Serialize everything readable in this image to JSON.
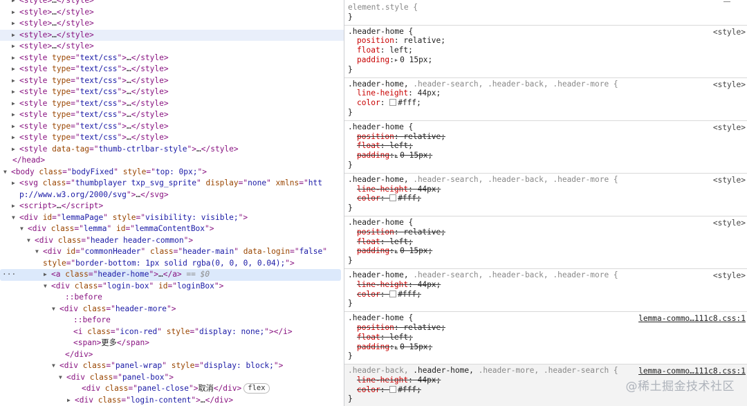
{
  "elements_tree": {
    "rows": [
      {
        "indent": 28,
        "arrow": "▶",
        "html": "<span class=\"tag\">&lt;style&gt;</span><span class=\"tx\">…</span><span class=\"tag\">&lt;/style&gt;</span>",
        "offset": -7
      },
      {
        "indent": 28,
        "arrow": "▶",
        "html": "<span class=\"tag\">&lt;style&gt;</span><span class=\"tx\">…</span><span class=\"tag\">&lt;/style&gt;</span>"
      },
      {
        "indent": 28,
        "arrow": "▶",
        "html": "<span class=\"tag\">&lt;style&gt;</span><span class=\"tx\">…</span><span class=\"tag\">&lt;/style&gt;</span>"
      },
      {
        "indent": 28,
        "arrow": "▶",
        "hl": "hover",
        "html": "<span class=\"tag\">&lt;style&gt;</span><span class=\"tx\">…</span><span class=\"tag\">&lt;/style&gt;</span>"
      },
      {
        "indent": 28,
        "arrow": "▶",
        "html": "<span class=\"tag\">&lt;style&gt;</span><span class=\"tx\">…</span><span class=\"tag\">&lt;/style&gt;</span>"
      },
      {
        "indent": 28,
        "arrow": "▶",
        "html": "<span class=\"tag\">&lt;style </span><span class=\"an\">type</span><span class=\"tag\">=\"</span><span class=\"av\">text/css</span><span class=\"tag\">\"&gt;</span><span class=\"tx\">…</span><span class=\"tag\">&lt;/style&gt;</span>"
      },
      {
        "indent": 28,
        "arrow": "▶",
        "html": "<span class=\"tag\">&lt;style </span><span class=\"an\">type</span><span class=\"tag\">=\"</span><span class=\"av\">text/css</span><span class=\"tag\">\"&gt;</span><span class=\"tx\">…</span><span class=\"tag\">&lt;/style&gt;</span>"
      },
      {
        "indent": 28,
        "arrow": "▶",
        "html": "<span class=\"tag\">&lt;style </span><span class=\"an\">type</span><span class=\"tag\">=\"</span><span class=\"av\">text/css</span><span class=\"tag\">\"&gt;</span><span class=\"tx\">…</span><span class=\"tag\">&lt;/style&gt;</span>"
      },
      {
        "indent": 28,
        "arrow": "▶",
        "html": "<span class=\"tag\">&lt;style </span><span class=\"an\">type</span><span class=\"tag\">=\"</span><span class=\"av\">text/css</span><span class=\"tag\">\"&gt;</span><span class=\"tx\">…</span><span class=\"tag\">&lt;/style&gt;</span>"
      },
      {
        "indent": 28,
        "arrow": "▶",
        "html": "<span class=\"tag\">&lt;style </span><span class=\"an\">type</span><span class=\"tag\">=\"</span><span class=\"av\">text/css</span><span class=\"tag\">\"&gt;</span><span class=\"tx\">…</span><span class=\"tag\">&lt;/style&gt;</span>"
      },
      {
        "indent": 28,
        "arrow": "▶",
        "html": "<span class=\"tag\">&lt;style </span><span class=\"an\">type</span><span class=\"tag\">=\"</span><span class=\"av\">text/css</span><span class=\"tag\">\"&gt;</span><span class=\"tx\">…</span><span class=\"tag\">&lt;/style&gt;</span>"
      },
      {
        "indent": 28,
        "arrow": "▶",
        "html": "<span class=\"tag\">&lt;style </span><span class=\"an\">type</span><span class=\"tag\">=\"</span><span class=\"av\">text/css</span><span class=\"tag\">\"&gt;</span><span class=\"tx\">…</span><span class=\"tag\">&lt;/style&gt;</span>"
      },
      {
        "indent": 28,
        "arrow": "▶",
        "html": "<span class=\"tag\">&lt;style </span><span class=\"an\">type</span><span class=\"tag\">=\"</span><span class=\"av\">text/css</span><span class=\"tag\">\"&gt;</span><span class=\"tx\">…</span><span class=\"tag\">&lt;/style&gt;</span>"
      },
      {
        "indent": 28,
        "arrow": "▶",
        "html": "<span class=\"tag\">&lt;style </span><span class=\"an\">data-tag</span><span class=\"tag\">=\"</span><span class=\"av\">thumb-ctrlbar-style</span><span class=\"tag\">\"&gt;</span><span class=\"tx\">…</span><span class=\"tag\">&lt;/style&gt;</span>"
      },
      {
        "indent": 28,
        "arrow": "",
        "html": "<span class=\"tag\">&lt;/head&gt;</span>",
        "shift": -10
      },
      {
        "indent": 16,
        "arrow": "▼",
        "html": "<span class=\"tag\">&lt;body </span><span class=\"an\">class</span><span class=\"tag\">=\"</span><span class=\"av\">bodyFixed</span><span class=\"tag\">\" </span><span class=\"an\">style</span><span class=\"tag\">=\"</span><span class=\"av\">top: 0px;</span><span class=\"tag\">\"&gt;</span>"
      },
      {
        "indent": 28,
        "arrow": "▶",
        "html": "<span class=\"tag\">&lt;svg </span><span class=\"an\">class</span><span class=\"tag\">=\"</span><span class=\"av\">thumbplayer txp_svg_sprite</span><span class=\"tag\">\" </span><span class=\"an\">display</span><span class=\"tag\">=\"</span><span class=\"av\">none</span><span class=\"tag\">\" </span><span class=\"an\">xmlns</span><span class=\"tag\">=\"</span><span class=\"av\">htt</span>"
      },
      {
        "indent": 28,
        "arrow": "",
        "html": "<span class=\"av\">p://www.w3.org/2000/svg</span><span class=\"tag\">\"&gt;</span><span class=\"tx\">…</span><span class=\"tag\">&lt;/svg&gt;</span>"
      },
      {
        "indent": 28,
        "arrow": "▶",
        "html": "<span class=\"tag\">&lt;script&gt;</span><span class=\"tx\">…</span><span class=\"tag\">&lt;/script&gt;</span>"
      },
      {
        "indent": 28,
        "arrow": "▼",
        "html": "<span class=\"tag\">&lt;div </span><span class=\"an\">id</span><span class=\"tag\">=\"</span><span class=\"av\">lemmaPage</span><span class=\"tag\">\" </span><span class=\"an\">style</span><span class=\"tag\">=\"</span><span class=\"av\">visibility: visible;</span><span class=\"tag\">\"&gt;</span>"
      },
      {
        "indent": 40,
        "arrow": "▼",
        "html": "<span class=\"tag\">&lt;div </span><span class=\"an\">class</span><span class=\"tag\">=\"</span><span class=\"av\">lemma</span><span class=\"tag\">\" </span><span class=\"an\">id</span><span class=\"tag\">=\"</span><span class=\"av\">lemmaContentBox</span><span class=\"tag\">\"&gt;</span>"
      },
      {
        "indent": 50,
        "arrow": "▼",
        "html": "<span class=\"tag\">&lt;div </span><span class=\"an\">class</span><span class=\"tag\">=\"</span><span class=\"av\">header header-common</span><span class=\"tag\">\"&gt;</span>"
      },
      {
        "indent": 62,
        "arrow": "▼",
        "html": "<span class=\"tag\">&lt;div </span><span class=\"an\">id</span><span class=\"tag\">=\"</span><span class=\"av\">commonHeader</span><span class=\"tag\">\" </span><span class=\"an\">class</span><span class=\"tag\">=\"</span><span class=\"av\">header-main</span><span class=\"tag\">\" </span><span class=\"an\">data-login</span><span class=\"tag\">=\"</span><span class=\"av\">false</span><span class=\"tag\">\"</span>"
      },
      {
        "indent": 62,
        "arrow": "",
        "html": "<span class=\"an\">style</span><span class=\"tag\">=\"</span><span class=\"av\">border-bottom: 1px solid rgba(0, 0, 0, 0.04);</span><span class=\"tag\">\"&gt;</span>"
      },
      {
        "indent": 74,
        "arrow": "▶",
        "hl": "selected",
        "dots": "···",
        "html": "<span class=\"tag\">&lt;a </span><span class=\"an\">class</span><span class=\"tag\">=\"</span><span class=\"av\">header-home</span><span class=\"tag\">\"&gt;</span><span class=\"tx\">…</span><span class=\"tag\">&lt;/a&gt;</span><span class=\"eq\"> == $0</span>"
      },
      {
        "indent": 74,
        "arrow": "▼",
        "html": "<span class=\"tag\">&lt;div </span><span class=\"an\">class</span><span class=\"tag\">=\"</span><span class=\"av\">login-box</span><span class=\"tag\">\" </span><span class=\"an\">id</span><span class=\"tag\">=\"</span><span class=\"av\">loginBox</span><span class=\"tag\">\"&gt;</span>"
      },
      {
        "indent": 94,
        "arrow": "",
        "html": "<span class=\"pseudo\">::before</span>"
      },
      {
        "indent": 86,
        "arrow": "▼",
        "html": "<span class=\"tag\">&lt;div </span><span class=\"an\">class</span><span class=\"tag\">=\"</span><span class=\"av\">header-more</span><span class=\"tag\">\"&gt;</span>"
      },
      {
        "indent": 106,
        "arrow": "",
        "html": "<span class=\"pseudo\">::before</span>"
      },
      {
        "indent": 106,
        "arrow": "",
        "html": "<span class=\"tag\">&lt;i </span><span class=\"an\">class</span><span class=\"tag\">=\"</span><span class=\"av\">icon-red</span><span class=\"tag\">\" </span><span class=\"an\">style</span><span class=\"tag\">=\"</span><span class=\"av\">display: none;</span><span class=\"tag\">\"&gt;&lt;/i&gt;</span>"
      },
      {
        "indent": 106,
        "arrow": "",
        "html": "<span class=\"tag\">&lt;span&gt;</span><span class=\"tx\">更多</span><span class=\"tag\">&lt;/span&gt;</span>"
      },
      {
        "indent": 94,
        "arrow": "",
        "html": "<span class=\"tag\">&lt;/div&gt;</span>"
      },
      {
        "indent": 86,
        "arrow": "▼",
        "html": "<span class=\"tag\">&lt;div </span><span class=\"an\">class</span><span class=\"tag\">=\"</span><span class=\"av\">panel-wrap</span><span class=\"tag\">\" </span><span class=\"an\">style</span><span class=\"tag\">=\"</span><span class=\"av\">display: block;</span><span class=\"tag\">\"&gt;</span>"
      },
      {
        "indent": 96,
        "arrow": "▼",
        "html": "<span class=\"tag\">&lt;div </span><span class=\"an\">class</span><span class=\"tag\">=\"</span><span class=\"av\">panel-box</span><span class=\"tag\">\"&gt;</span>"
      },
      {
        "indent": 118,
        "arrow": "",
        "html": "<span class=\"tag\">&lt;div </span><span class=\"an\">class</span><span class=\"tag\">=\"</span><span class=\"av\">panel-close</span><span class=\"tag\">\"&gt;</span><span class=\"tx\">取消</span><span class=\"tag\">&lt;/div&gt;</span><span class=\"badge\">flex</span>"
      },
      {
        "indent": 108,
        "arrow": "▶",
        "html": "<span class=\"tag\">&lt;div </span><span class=\"an\">class</span><span class=\"tag\">=\"</span><span class=\"av\">login-content</span><span class=\"tag\">\"&gt;</span><span class=\"tx\">…</span><span class=\"tag\">&lt;/div&gt;</span>"
      }
    ]
  },
  "styles": {
    "element_style": "element.style {",
    "close_brace": "}",
    "style_origin": "<style>",
    "link_origin": "lemma-commo…111c8.css:1",
    "sel_header_home": ".header-home {",
    "sel_combo_a_1": ".header-home,",
    "sel_combo_a_2": " .header-search, .header-back, .header-more {",
    "sel_combo_b_1": ".header-back,",
    "sel_combo_b_2": " .header-home,",
    "sel_combo_b_3": " .header-more,",
    "sel_combo_b_4": " .header-search {",
    "p_position": "position",
    "v_relative": "relative;",
    "p_float": "float",
    "v_left": "left;",
    "p_padding": "padding",
    "v_padding": "0 15px;",
    "p_line_height": "line-height",
    "v_44": "44px;",
    "p_color": "color",
    "v_fff": "#fff;",
    "colon": ":"
  },
  "watermark": "@稀土掘金技术社区"
}
